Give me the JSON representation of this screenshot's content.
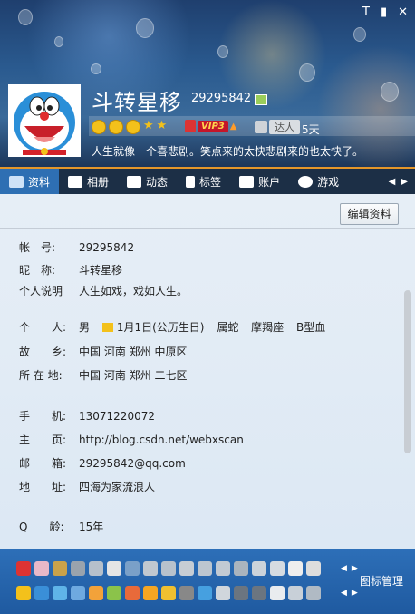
{
  "window": {
    "controls": [
      "T",
      "▮",
      "✕"
    ]
  },
  "profile": {
    "nickname": "斗转星移",
    "qq_number": "29295842",
    "vip_label": "VIP3",
    "vip_arrow": "▲",
    "talent_label": "达人",
    "days": "5天",
    "signature": "人生就像一个喜悲剧。笑点来的太快悲剧来的也太快了。"
  },
  "tabs": [
    {
      "label": "资料",
      "icon": "id-card-icon"
    },
    {
      "label": "相册",
      "icon": "photo-album-icon"
    },
    {
      "label": "动态",
      "icon": "list-icon"
    },
    {
      "label": "标签",
      "icon": "bookmark-icon"
    },
    {
      "label": "账户",
      "icon": "wallet-icon"
    },
    {
      "label": "游戏",
      "icon": "game-icon"
    }
  ],
  "tab_arrows": {
    "left": "◀",
    "right": "▶"
  },
  "edit_button": "编辑资料",
  "info": {
    "account_label": "帐　号:",
    "account": "29295842",
    "nick_label": "昵　称:",
    "nick": "斗转星移",
    "desc_label": "个人说明",
    "desc": "人生如戏，戏如人生。",
    "person_label": "个　　人:",
    "gender": "男",
    "birthday": "1月1日(公历生日)",
    "zodiac": "属蛇",
    "constellation": "摩羯座",
    "blood": "B型血",
    "hometown_label": "故　　乡:",
    "hometown": "中国 河南 郑州 中原区",
    "location_label": "所 在 地:",
    "location": "中国 河南 郑州 二七区",
    "phone_label": "手　　机:",
    "phone": "13071220072",
    "homepage_label": "主　　页:",
    "homepage": "http://blog.csdn.net/webxscan",
    "email_label": "邮　　箱:",
    "email": "29295842@qq.com",
    "address_label": "地　　址:",
    "address": "四海为家流浪人",
    "age_label": "Q　　龄:",
    "age": "15年"
  },
  "bottom_bar": {
    "manage_label": "图标管理",
    "arrows": [
      "◀",
      "▶"
    ]
  },
  "colors": {
    "tab_bar": "#1c2f46",
    "tab_active": "#2e6fb3",
    "bottom_bar": "#2d6fb8",
    "accent_line": "#e4962a"
  }
}
